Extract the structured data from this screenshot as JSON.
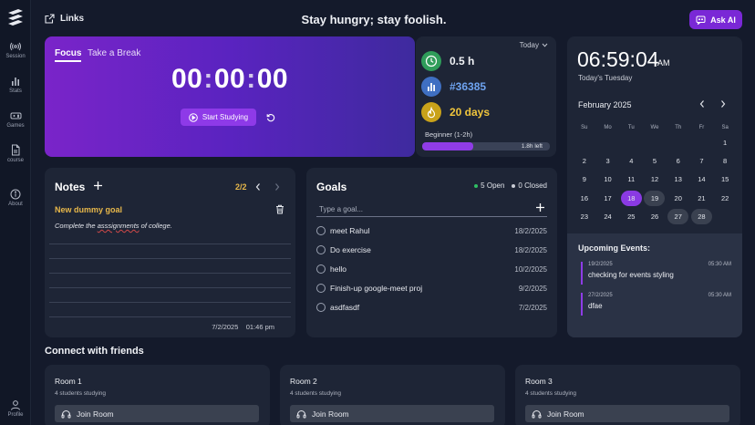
{
  "sidebar": {
    "items": [
      {
        "label": "Session",
        "icon": "broadcast-icon"
      },
      {
        "label": "Stats",
        "icon": "bar-chart-icon"
      },
      {
        "label": "Games",
        "icon": "gamepad-icon"
      },
      {
        "label": "course",
        "icon": "document-icon"
      },
      {
        "label": "About",
        "icon": "info-icon"
      },
      {
        "label": "Profile",
        "icon": "user-icon"
      }
    ]
  },
  "header": {
    "links_label": "Links",
    "quote": "Stay hungry; stay foolish.",
    "ask_ai_label": "Ask AI"
  },
  "focus": {
    "tab_focus": "Focus",
    "tab_break": "Take a Break",
    "hours": "00",
    "minutes": "00",
    "seconds": "00",
    "start_label": "Start Studying"
  },
  "stats": {
    "period": "Today",
    "hours": "0.5 h",
    "rank": "#36385",
    "streak": "20 days",
    "level": "Beginner (1-2h)",
    "progress": 0.4,
    "remaining": "1.8h left",
    "colors": {
      "hours": "#2f9d5a",
      "rank": "#3f6fc2",
      "streak": "#c9a21a",
      "accent": "#8f3ce6"
    }
  },
  "clock": {
    "time": "06:59:04",
    "ampm": "AM",
    "day": "Today's Tuesday"
  },
  "calendar": {
    "month": "February 2025",
    "weekdays": [
      "Su",
      "Mo",
      "Tu",
      "We",
      "Th",
      "Fr",
      "Sa"
    ],
    "days": [
      "",
      "",
      "",
      "",
      "",
      "",
      "1",
      "2",
      "3",
      "4",
      "5",
      "6",
      "7",
      "8",
      "9",
      "10",
      "11",
      "12",
      "13",
      "14",
      "15",
      "16",
      "17",
      "18",
      "19",
      "20",
      "21",
      "22",
      "23",
      "24",
      "25",
      "26",
      "27",
      "28",
      ""
    ],
    "selected": "18",
    "highlighted": [
      "19",
      "27",
      "28"
    ]
  },
  "events": {
    "title": "Upcoming Events:",
    "items": [
      {
        "date": "19/2/2025",
        "time": "05:30 AM",
        "name": "checking for events styling"
      },
      {
        "date": "27/2/2025",
        "time": "05:30 AM",
        "name": "dfae"
      }
    ]
  },
  "notes": {
    "title": "Notes",
    "page": "2/2",
    "note_title": "New dummy goal",
    "body_before": "Complete the ",
    "body_misspelled": "asssignments",
    "body_after": " of college.",
    "footer": "7/2/2025    01:46 pm"
  },
  "goals": {
    "title": "Goals",
    "open": "5 Open",
    "closed": "0 Closed",
    "placeholder": "Type a goal...",
    "items": [
      {
        "name": "meet Rahul",
        "date": "18/2/2025"
      },
      {
        "name": "Do exercise",
        "date": "18/2/2025"
      },
      {
        "name": "hello",
        "date": "10/2/2025"
      },
      {
        "name": "Finish-up google-meet proj",
        "date": "9/2/2025"
      },
      {
        "name": "asdfasdf",
        "date": "7/2/2025"
      }
    ],
    "colors": {
      "open": "#2fbf63",
      "closed": "#c9ccd5"
    }
  },
  "friends": {
    "title": "Connect with friends",
    "rooms": [
      {
        "name": "Room 1",
        "count": "4 students studying",
        "join": "Join Room"
      },
      {
        "name": "Room 2",
        "count": "4 students studying",
        "join": "Join Room"
      },
      {
        "name": "Room 3",
        "count": "4 students studying",
        "join": "Join Room"
      }
    ]
  }
}
